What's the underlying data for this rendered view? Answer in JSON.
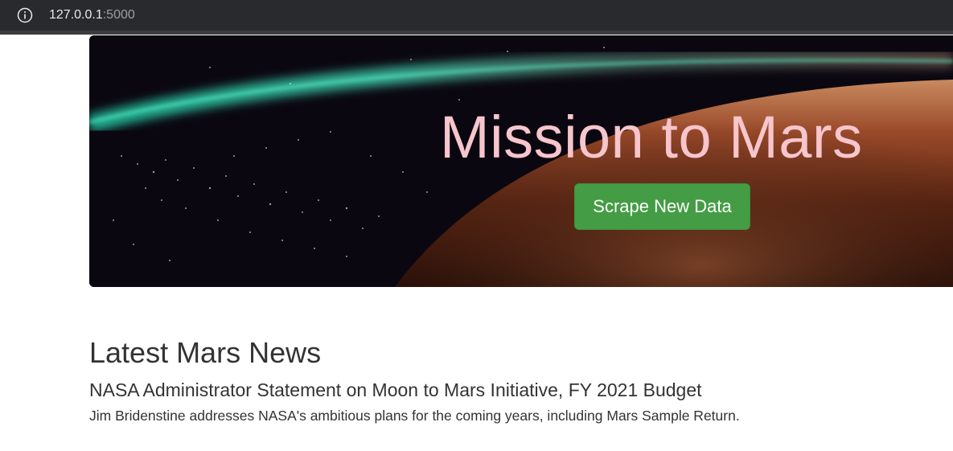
{
  "browser": {
    "url_host": "127.0.0.1",
    "url_port": ":5000",
    "info_icon": "info-icon"
  },
  "jumbotron": {
    "title": "Mission to Mars",
    "button_label": "Scrape New Data",
    "button_color": "#449d44",
    "title_color": "#f7c5cc"
  },
  "news": {
    "section_heading": "Latest Mars News",
    "article_title": "NASA Administrator Statement on Moon to Mars Initiative, FY 2021 Budget",
    "article_teaser": "Jim Bridenstine addresses NASA's ambitious plans for the coming years, including Mars Sample Return."
  }
}
